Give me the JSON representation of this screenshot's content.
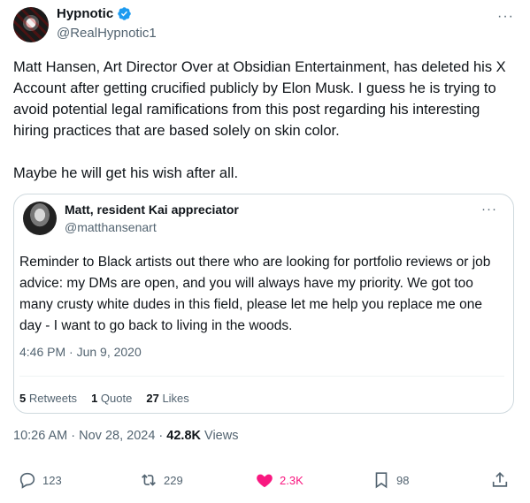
{
  "author": {
    "display_name": "Hypnotic",
    "handle": "@RealHypnotic1"
  },
  "tweet": {
    "text": "Matt Hansen, Art Director Over at Obsidian Entertainment, has deleted his X Account after getting crucified publicly by Elon Musk. I guess he is trying to avoid potential legal ramifications from this post regarding his interesting hiring practices that are based solely on skin color.\n\nMaybe he will get his wish after all."
  },
  "quoted": {
    "display_name": "Matt, resident Kai appreciator",
    "handle": "@matthansenart",
    "text": "Reminder to Black artists out there who are looking for portfolio reviews or job advice: my DMs are open, and you will always have my priority. We got too many crusty white dudes in this field, please let me help you replace me one day - I want to go back to living in the woods.",
    "timestamp": "4:46 PM · Jun 9, 2020",
    "retweets_count": "5",
    "retweets_label": "Retweets",
    "quotes_count": "1",
    "quotes_label": "Quote",
    "likes_count": "27",
    "likes_label": "Likes"
  },
  "meta": {
    "timestamp": "10:26 AM · Nov 28, 2024 · ",
    "views_count": "42.8K",
    "views_label": "Views"
  },
  "actions": {
    "replies": "123",
    "reposts": "229",
    "likes": "2.3K",
    "bookmarks": "98"
  },
  "colors": {
    "verified": "#1d9bf0",
    "like": "#f91880",
    "secondary_text": "#536471"
  },
  "more_glyph": "···"
}
